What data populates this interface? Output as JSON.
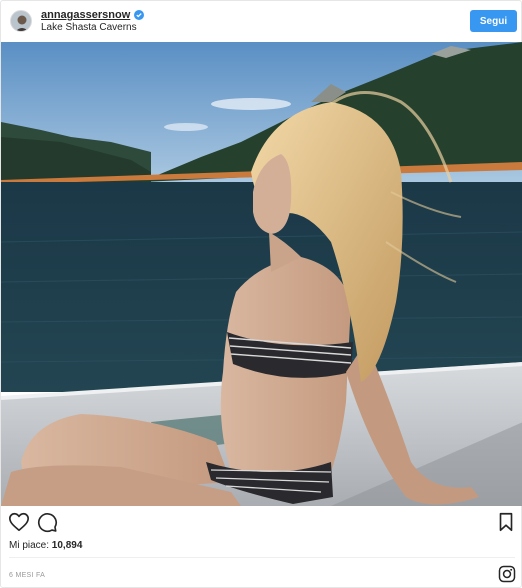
{
  "post": {
    "username": "annagassersnow",
    "location": "Lake Shasta Caverns",
    "follow_label": "Segui",
    "likes_label": "Mi piace:",
    "likes_count": "10,894",
    "time_ago": "6 MESI FA"
  },
  "icons": {
    "verified": "verified-badge-icon",
    "like": "heart-icon",
    "comment": "comment-icon",
    "save": "bookmark-icon",
    "brand": "instagram-logo-icon"
  },
  "colors": {
    "accent": "#3897f0",
    "text": "#262626",
    "muted": "#999999"
  }
}
